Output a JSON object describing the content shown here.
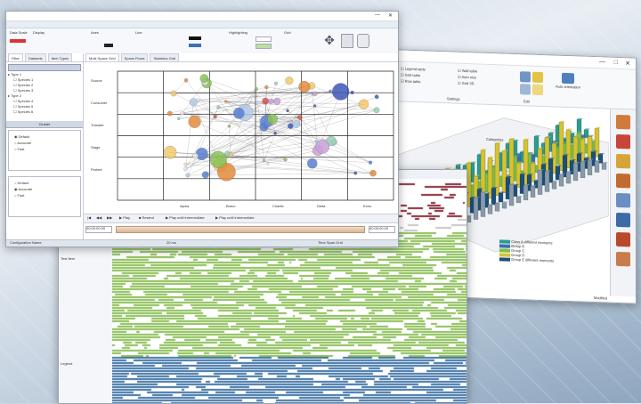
{
  "bubble_window": {
    "menu_label": "General",
    "toolbar_groups": [
      "Data Scale",
      "Display",
      "Axes",
      "Line",
      "Highlighting",
      "Grid"
    ],
    "tabs": [
      "Filter",
      "Datasets",
      "Item Types"
    ],
    "main_tabs": [
      "Multi Space Grid",
      "Spans Flows",
      "Statistics Grid"
    ],
    "tree_items": [
      "Type 1",
      "Species 1",
      "Species 2",
      "Species 3",
      "Type 2",
      "Species 4",
      "Species 5",
      "Species 6"
    ],
    "panel_title": "Cluster",
    "radio_group_a": [
      "Default",
      "Accurate",
      "Fast"
    ],
    "radio_group_b": [
      "Default",
      "Accurate",
      "Fast"
    ],
    "row_labels": [
      "Source",
      "Consumer",
      "Transfer",
      "Stage",
      "Protect"
    ],
    "col_labels": [
      "Alpha",
      "Bravo",
      "Charlie",
      "Delta",
      "Echo"
    ],
    "play_buttons": [
      "Play",
      "Rewind",
      "Play until intermediate",
      "Play until intermediate"
    ],
    "time_field": "00:00:00.00",
    "status_left": "Configuration Name",
    "status_mid": "20 ms",
    "status_right": "Time Span Grid"
  },
  "bar3d_window": {
    "ribbon_checks": [
      "Legend table",
      "Grid table",
      "Row table",
      "Wall table",
      "Auto size",
      "Grid 3D"
    ],
    "ribbon_groups": [
      "Settings",
      "Edit"
    ],
    "ribbon_button": "Auto orientation",
    "chart_title": "Categories",
    "legend": [
      {
        "label": "Class A different moments",
        "color": "#2c9c8f"
      },
      {
        "label": "Group B",
        "color": "#3b6fb0"
      },
      {
        "label": "Group C",
        "color": "#7fbf4b"
      },
      {
        "label": "Group D",
        "color": "#d8c22e"
      },
      {
        "label": "Group E different moments",
        "color": "#1d4f7a"
      }
    ],
    "status": "Modified"
  },
  "raster_window": {
    "row_label_top": "Test Item",
    "row_label_bottom": "Legend"
  },
  "colors": {
    "accent": "#3b6fb0",
    "green": "#8cbf58",
    "maroon": "#8a2a3a",
    "steel": "#3f74a8"
  }
}
